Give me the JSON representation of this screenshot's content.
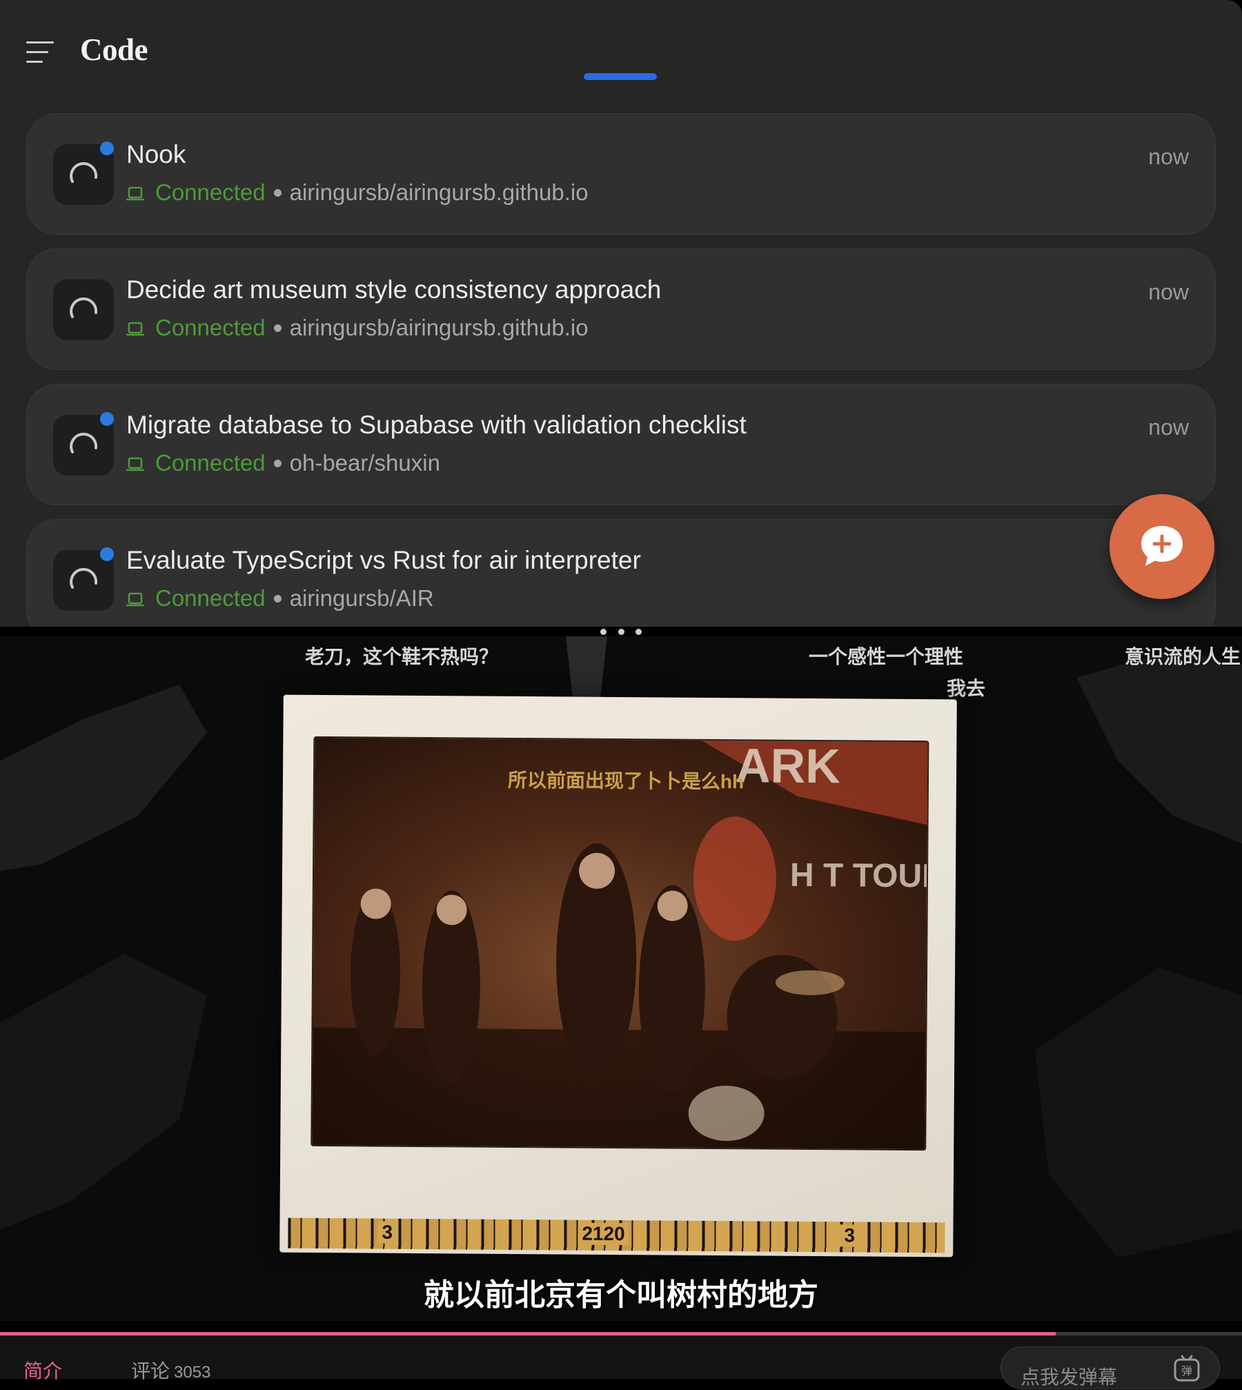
{
  "app": {
    "title": "Code",
    "sessions": [
      {
        "title": "Nook",
        "status": "Connected",
        "repo": "airingursb/airingursb.github.io",
        "time": "now",
        "unread": true
      },
      {
        "title": "Decide art museum style consistency approach",
        "status": "Connected",
        "repo": "airingursb/airingursb.github.io",
        "time": "now",
        "unread": false
      },
      {
        "title": "Migrate database to Supabase with validation checklist",
        "status": "Connected",
        "repo": "oh-bear/shuxin",
        "time": "now",
        "unread": true
      },
      {
        "title": "Evaluate TypeScript vs Rust for air interpreter",
        "status": "Connected",
        "repo": "airingursb/AIR",
        "time": "",
        "unread": true
      }
    ],
    "colors": {
      "accent": "#2b6de0",
      "status_connected": "#4e9a3a",
      "fab": "#d86a45",
      "background": "#262624",
      "card": "#303030"
    }
  },
  "video": {
    "danmaku": [
      "老刀，这个鞋不热吗？",
      "一个感性一个理性",
      "意识流的人生",
      "我去",
      "所以前面出现了卜卜是么hh"
    ],
    "ruler_numbers": [
      "3",
      "2120",
      "3"
    ],
    "subtitle": "就以前北京有个叫树村的地方",
    "progress": 0.85,
    "progress_color": "#e8608a"
  },
  "bottom": {
    "tab_intro": "简介",
    "tab_comments": "评论",
    "comment_count": "3053",
    "danmaku_placeholder": "点我发弹幕",
    "danmaku_icon_label": "弹"
  }
}
